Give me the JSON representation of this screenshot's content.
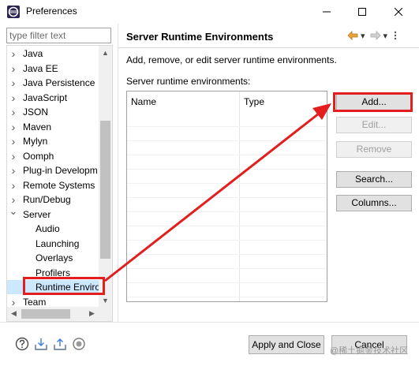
{
  "window": {
    "title": "Preferences"
  },
  "sidebar": {
    "filter_placeholder": "type filter text",
    "items": [
      {
        "label": "Java",
        "expander": "right"
      },
      {
        "label": "Java EE",
        "expander": "right"
      },
      {
        "label": "Java Persistence",
        "expander": "right"
      },
      {
        "label": "JavaScript",
        "expander": "right"
      },
      {
        "label": "JSON",
        "expander": "right"
      },
      {
        "label": "Maven",
        "expander": "right"
      },
      {
        "label": "Mylyn",
        "expander": "right"
      },
      {
        "label": "Oomph",
        "expander": "right"
      },
      {
        "label": "Plug-in Developm",
        "expander": "right"
      },
      {
        "label": "Remote Systems",
        "expander": "right"
      },
      {
        "label": "Run/Debug",
        "expander": "right"
      },
      {
        "label": "Server",
        "expander": "down"
      },
      {
        "label": "Audio",
        "expander": "none"
      },
      {
        "label": "Launching",
        "expander": "none"
      },
      {
        "label": "Overlays",
        "expander": "none"
      },
      {
        "label": "Profilers",
        "expander": "none"
      },
      {
        "label": "Runtime Enviro",
        "expander": "none",
        "selected": true
      },
      {
        "label": "Team",
        "expander": "right"
      }
    ]
  },
  "main": {
    "title": "Server Runtime Environments",
    "description": "Add, remove, or edit server runtime environments.",
    "list_label": "Server runtime environments:",
    "table": {
      "columns": [
        "Name",
        "Type"
      ],
      "rows": []
    },
    "buttons": [
      {
        "label": "Add...",
        "enabled": true,
        "highlighted": true
      },
      {
        "label": "Edit...",
        "enabled": false
      },
      {
        "label": "Remove",
        "enabled": false
      },
      {
        "label": "Search...",
        "enabled": true
      },
      {
        "label": "Columns...",
        "enabled": true
      }
    ]
  },
  "footer": {
    "apply_close_label": "Apply and Close",
    "cancel_label": "Cancel"
  },
  "watermark": "@稀土掘金技术社区",
  "colors": {
    "annotation_red": "#e21e1e",
    "selection_blue": "#cce8ff",
    "nav_arrow_orange": "#e8a33c"
  },
  "icons": [
    "eclipse-app-icon",
    "minimize-icon",
    "maximize-icon",
    "close-icon",
    "back-arrow-icon",
    "forward-arrow-icon",
    "menu-dropdown-icon",
    "help-icon",
    "import-icon",
    "export-icon",
    "oomph-record-icon"
  ]
}
